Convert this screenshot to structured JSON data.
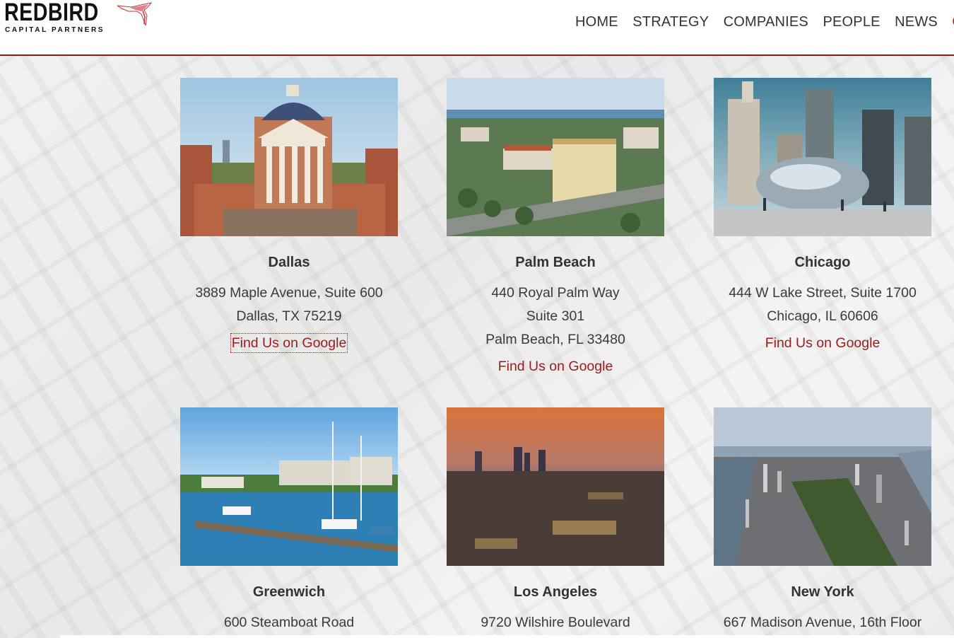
{
  "brand": {
    "name": "REDBIRD",
    "subtitle": "CAPITAL PARTNERS",
    "accent_color": "#9e1b1b"
  },
  "nav": {
    "items": [
      {
        "label": "HOME"
      },
      {
        "label": "STRATEGY"
      },
      {
        "label": "COMPANIES"
      },
      {
        "label": "PEOPLE"
      },
      {
        "label": "NEWS"
      },
      {
        "label": "CO"
      }
    ]
  },
  "offices": [
    {
      "city": "Dallas",
      "address": [
        "3889 Maple Avenue, Suite 600",
        "Dallas, TX 75219"
      ],
      "link": "Find Us on Google",
      "photo": "dallas-building-photo"
    },
    {
      "city": "Palm Beach",
      "address": [
        "440 Royal Palm Way",
        "Suite 301",
        "Palm Beach, FL 33480"
      ],
      "link": "Find Us on Google",
      "photo": "palm-beach-aerial-photo"
    },
    {
      "city": "Chicago",
      "address": [
        "444 W Lake Street, Suite 1700",
        "Chicago, IL 60606"
      ],
      "link": "Find Us on Google",
      "photo": "chicago-bean-photo"
    },
    {
      "city": "Greenwich",
      "address": [
        "600 Steamboat Road"
      ],
      "link": "",
      "photo": "greenwich-marina-photo"
    },
    {
      "city": "Los Angeles",
      "address": [
        "9720 Wilshire Boulevard"
      ],
      "link": "",
      "photo": "los-angeles-skyline-photo"
    },
    {
      "city": "New York",
      "address": [
        "667 Madison Avenue, 16th Floor"
      ],
      "link": "",
      "photo": "new-york-aerial-photo"
    }
  ]
}
